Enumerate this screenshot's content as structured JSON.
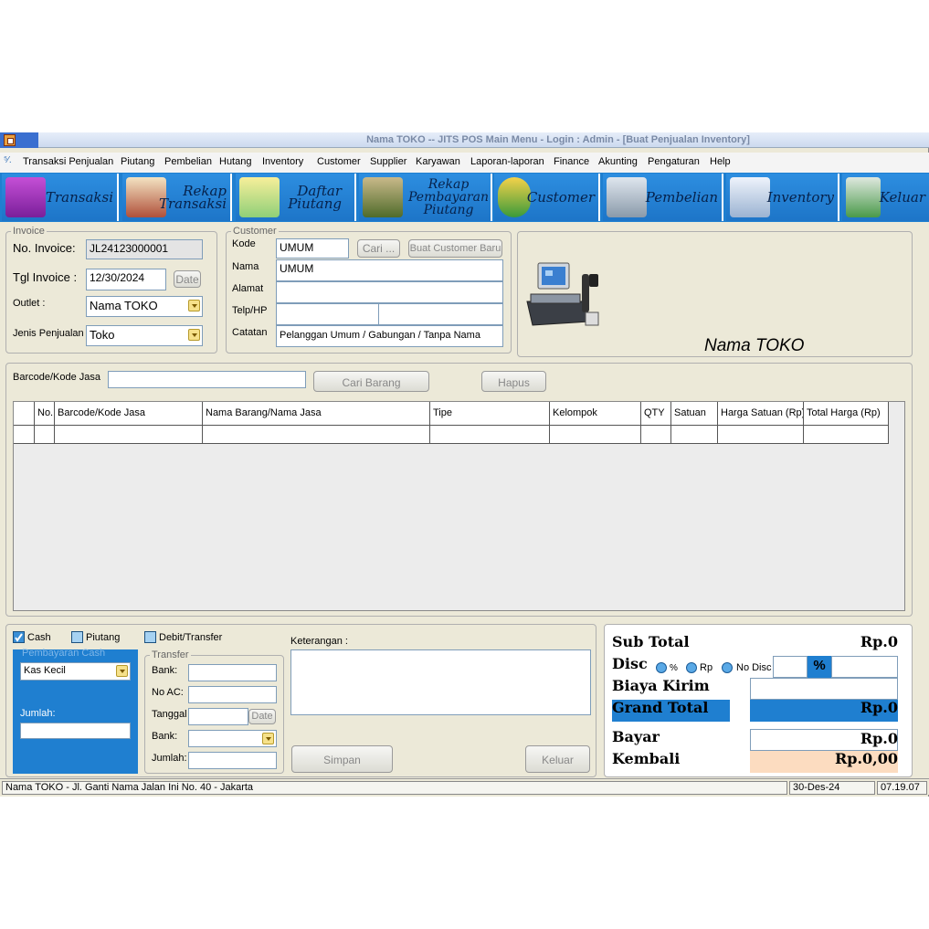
{
  "window": {
    "title": "Nama TOKO -- JITS POS Main Menu - Login : Admin - [Buat Penjualan Inventory]"
  },
  "menu": [
    "Transaksi Penjualan",
    "Piutang",
    "Pembelian",
    "Hutang",
    "Inventory",
    "Customer",
    "Supplier",
    "Karyawan",
    "Laporan-laporan",
    "Finance",
    "Akunting",
    "Pengaturan",
    "Help"
  ],
  "toolbar": {
    "transaksi": "Transaksi",
    "rekap_transaksi_1": "Rekap",
    "rekap_transaksi_2": "Transaksi",
    "daftar_piutang_1": "Daftar",
    "daftar_piutang_2": "Piutang",
    "rekap_pembayaran_1": "Rekap",
    "rekap_pembayaran_2": "Pembayaran",
    "rekap_pembayaran_3": "Piutang",
    "customer": "Customer",
    "pembelian": "Pembelian",
    "inventory": "Inventory",
    "keluar": "Keluar"
  },
  "invoice": {
    "legend": "Invoice",
    "no_label": "No. Invoice:",
    "no_value": "JL24123000001",
    "tgl_label": "Tgl Invoice :",
    "tgl_value": "12/30/2024",
    "date_btn": "Date",
    "outlet_label": "Outlet :",
    "outlet_value": "Nama TOKO",
    "jenis_label": "Jenis Penjualan :",
    "jenis_value": "Toko"
  },
  "customer": {
    "legend": "Customer",
    "kode_label": "Kode",
    "kode_value": "UMUM",
    "cari_btn": "Cari ...",
    "buat_btn": "Buat Customer Baru",
    "nama_label": "Nama",
    "nama_value": "UMUM",
    "alamat_label": "Alamat",
    "telp_label": "Telp/HP",
    "catatan_label": "Catatan",
    "catatan_value": "Pelanggan Umum / Gabungan / Tanpa Nama"
  },
  "store_name": "Nama TOKO",
  "barcode": {
    "label": "Barcode/Kode Jasa",
    "cari_btn": "Cari Barang",
    "hapus_btn": "Hapus"
  },
  "table": {
    "columns": [
      "No.",
      "Barcode/Kode Jasa",
      "Nama Barang/Nama Jasa",
      "Tipe",
      "Kelompok",
      "QTY",
      "Satuan",
      "Harga Satuan (Rp)",
      "Total Harga (Rp)"
    ]
  },
  "payment": {
    "cash": "Cash",
    "piutang": "Piutang",
    "debit": "Debit/Transfer",
    "cash_legend": "Pembayaran Cash",
    "kas_value": "Kas Kecil",
    "jumlah_label": "Jumlah:",
    "transfer_legend": "Transfer",
    "bank_label": "Bank:",
    "noac_label": "No AC:",
    "tanggal_label": "Tanggal",
    "date_btn": "Date",
    "bank2_label": "Bank:",
    "jumlah2_label": "Jumlah:",
    "keterangan_label": "Keterangan :",
    "simpan_btn": "Simpan",
    "keluar_btn": "Keluar"
  },
  "summary": {
    "subtotal_label": "Sub Total",
    "subtotal_value": "Rp.0",
    "disc_label": "Disc",
    "disc_pct": "%",
    "disc_rp": "Rp",
    "disc_none": "No Disc",
    "disc_symbol": "%",
    "biaya_label": "Biaya Kirim",
    "grand_label": "Grand Total",
    "grand_value": "Rp.0",
    "bayar_label": "Bayar",
    "bayar_value": "Rp.0",
    "kembali_label": "Kembali",
    "kembali_value": "Rp.0,00"
  },
  "status": {
    "address": "Nama TOKO - Jl. Ganti Nama Jalan Ini No. 40 - Jakarta",
    "date": "30-Des-24",
    "time": "07.19.07"
  },
  "colors": {
    "accent": "#1f7fd0",
    "kembali_bg": "#fcdcc0"
  }
}
